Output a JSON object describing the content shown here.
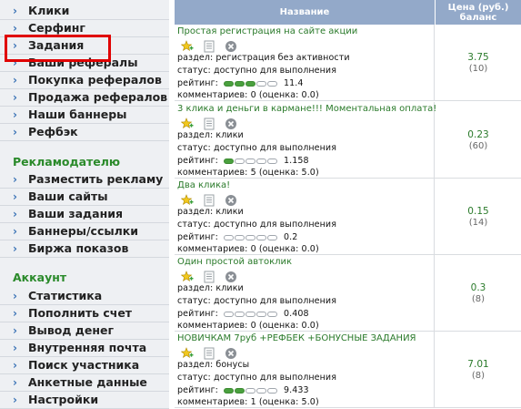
{
  "sidebar": {
    "top_items": [
      {
        "label": "Клики"
      },
      {
        "label": "Серфинг"
      },
      {
        "label": "Задания"
      },
      {
        "label": "Ваши рефералы"
      },
      {
        "label": "Покупка рефералов"
      },
      {
        "label": "Продажа рефералов"
      },
      {
        "label": "Наши баннеры"
      },
      {
        "label": "Рефбэк"
      }
    ],
    "advertiser_title": "Рекламодателю",
    "advertiser_items": [
      {
        "label": "Разместить рекламу"
      },
      {
        "label": "Ваши сайты"
      },
      {
        "label": "Ваши задания"
      },
      {
        "label": "Баннеры/ссылки"
      },
      {
        "label": "Биржа показов"
      }
    ],
    "account_title": "Аккаунт",
    "account_items": [
      {
        "label": "Статистика"
      },
      {
        "label": "Пополнить счет"
      },
      {
        "label": "Вывод денег"
      },
      {
        "label": "Внутренняя почта"
      },
      {
        "label": "Поиск участника"
      },
      {
        "label": "Анкетные данные"
      },
      {
        "label": "Настройки"
      }
    ]
  },
  "table": {
    "header_name": "Название",
    "header_price": "Цена (руб.) баланс",
    "rows": [
      {
        "title": "Простая регистрация на сайте акции",
        "section": "раздел: регистрация без активности",
        "status": "статус: доступно для выполнения",
        "rating_label": "рейтинг:",
        "rating_value": "11.4",
        "rating_level": 3,
        "comments": "комментариев: 0 (оценка: 0.0)",
        "price": "3.75",
        "count": "(10)"
      },
      {
        "title": "3 клика и деньги в кармане!!! Моментальная оплата!",
        "section": "раздел: клики",
        "status": "статус: доступно для выполнения",
        "rating_label": "рейтинг:",
        "rating_value": "1.158",
        "rating_level": 1,
        "comments": "комментариев: 5 (оценка: 5.0)",
        "price": "0.23",
        "count": "(60)"
      },
      {
        "title": "Два клика!",
        "section": "раздел: клики",
        "status": "статус: доступно для выполнения",
        "rating_label": "рейтинг:",
        "rating_value": "0.2",
        "rating_level": 0,
        "comments": "комментариев: 0 (оценка: 0.0)",
        "price": "0.15",
        "count": "(14)"
      },
      {
        "title": "Один простой автоклик",
        "section": "раздел: клики",
        "status": "статус: доступно для выполнения",
        "rating_label": "рейтинг:",
        "rating_value": "0.408",
        "rating_level": 0,
        "comments": "комментариев: 0 (оценка: 0.0)",
        "price": "0.3",
        "count": "(8)"
      },
      {
        "title": "НОВИЧКАМ 7руб +РЕФБЕК +БОНУСНЫЕ ЗАДАНИЯ",
        "section": "раздел: бонусы",
        "status": "статус: доступно для выполнения",
        "rating_label": "рейтинг:",
        "rating_value": "9.433",
        "rating_level": 2,
        "comments": "комментариев: 1 (оценка: 5.0)",
        "price": "7.01",
        "count": "(8)"
      }
    ]
  },
  "colors": {
    "accent_green": "#2a8a2a",
    "header_blue": "#93a9c9",
    "highlight_red": "#e00000"
  }
}
